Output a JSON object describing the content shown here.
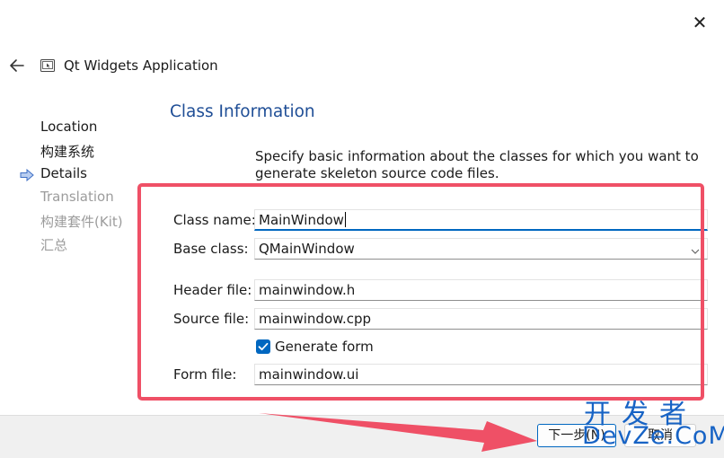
{
  "window": {
    "title": "Qt Widgets Application",
    "close_symbol": "✕"
  },
  "steps": [
    {
      "label": "Location",
      "state": "done"
    },
    {
      "label": "构建系统",
      "state": "done"
    },
    {
      "label": "Details",
      "state": "current"
    },
    {
      "label": "Translation",
      "state": "pending"
    },
    {
      "label": "构建套件(Kit)",
      "state": "pending"
    },
    {
      "label": "汇总",
      "state": "pending"
    }
  ],
  "page": {
    "title": "Class Information",
    "description": "Specify basic information about the classes for which you want to generate skeleton source code files."
  },
  "form": {
    "class_name": {
      "label": "Class name:",
      "value": "MainWindow"
    },
    "base_class": {
      "label": "Base class:",
      "value": "QMainWindow"
    },
    "header_file": {
      "label": "Header file:",
      "value": "mainwindow.h"
    },
    "source_file": {
      "label": "Source file:",
      "value": "mainwindow.cpp"
    },
    "generate_form": {
      "label": "Generate form",
      "checked": true
    },
    "form_file": {
      "label": "Form file:",
      "value": "mainwindow.ui"
    }
  },
  "buttons": {
    "next": "下一步(N)",
    "cancel": "取消"
  },
  "annotation": {
    "highlight_color": "#ef5066"
  },
  "watermark": {
    "cn": "开发者",
    "en": "DevZe.CoM"
  },
  "colors": {
    "accent": "#0067c0",
    "section_title": "#1f4e96",
    "watermark": "#1763c5"
  }
}
